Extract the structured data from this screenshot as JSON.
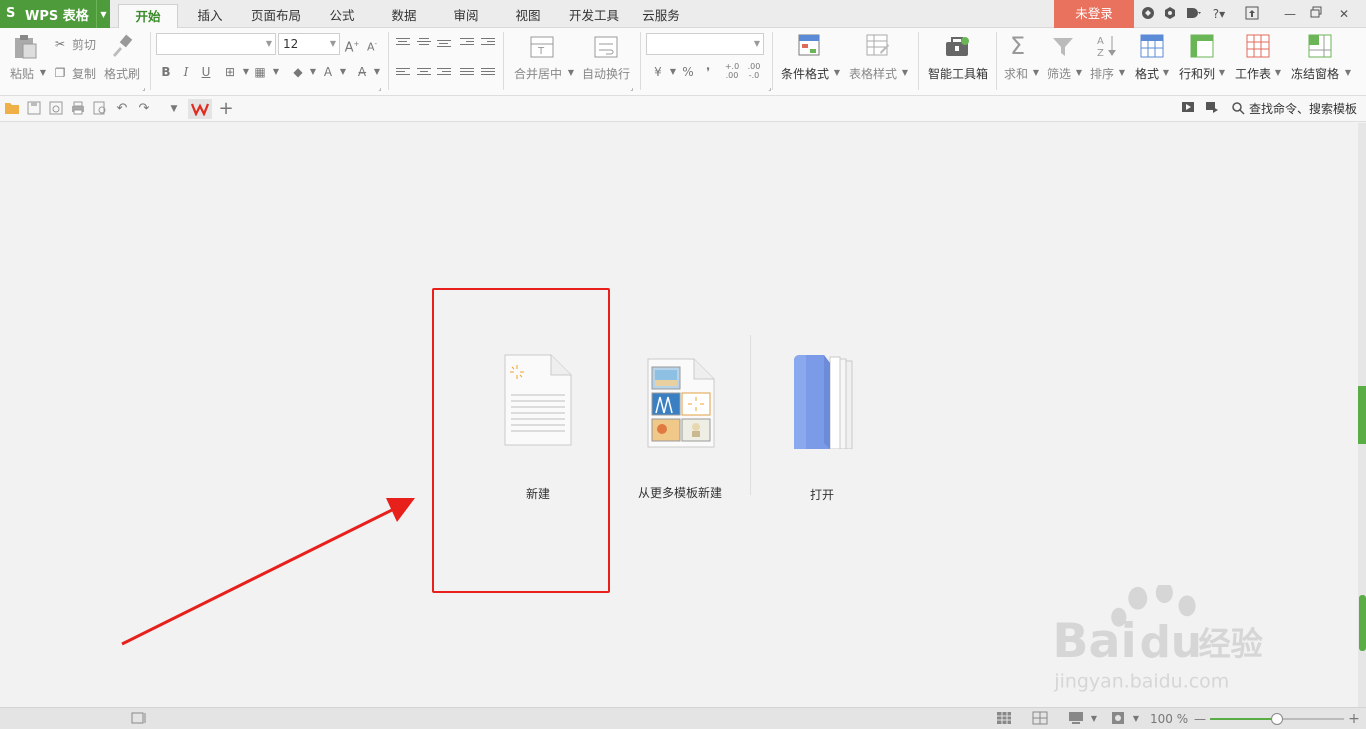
{
  "app": {
    "logo": "S",
    "title": "WPS 表格",
    "login_label": "未登录"
  },
  "tabs": [
    {
      "label": "开始",
      "active": true
    },
    {
      "label": "插入"
    },
    {
      "label": "页面布局"
    },
    {
      "label": "公式"
    },
    {
      "label": "数据"
    },
    {
      "label": "审阅"
    },
    {
      "label": "视图"
    },
    {
      "label": "开发工具"
    },
    {
      "label": "云服务"
    }
  ],
  "ribbon": {
    "paste": "粘贴",
    "cut": "剪切",
    "copy": "复制",
    "format_painter": "格式刷",
    "font_name": "",
    "font_size": "12",
    "bold": "B",
    "italic": "I",
    "underline": "U",
    "merge_center": "合并居中",
    "wrap_text": "自动换行",
    "number_format": "",
    "percent": "%",
    "comma": "❜",
    "conditional_format": "条件格式",
    "table_style": "表格样式",
    "smart_toolbox": "智能工具箱",
    "sum": "求和",
    "filter": "筛选",
    "sort": "排序",
    "format": "格式",
    "row_col": "行和列",
    "worksheet": "工作表",
    "freeze": "冻结窗格"
  },
  "quickbar": {
    "search_label": "查找命令、搜索模板"
  },
  "start": {
    "new_label": "新建",
    "template_label": "从更多模板新建",
    "open_label": "打开"
  },
  "statusbar": {
    "zoom_label": "100 %",
    "zoom_fraction": 0.5
  },
  "watermark": {
    "brand": "Bai",
    "brand_tail": "经验",
    "url": "jingyan.baidu.com"
  },
  "colors": {
    "brand_green": "#4e9b3b",
    "login_red": "#e9725f",
    "highlight_red": "#e8201c",
    "folder_blue": "#7b9be8"
  }
}
